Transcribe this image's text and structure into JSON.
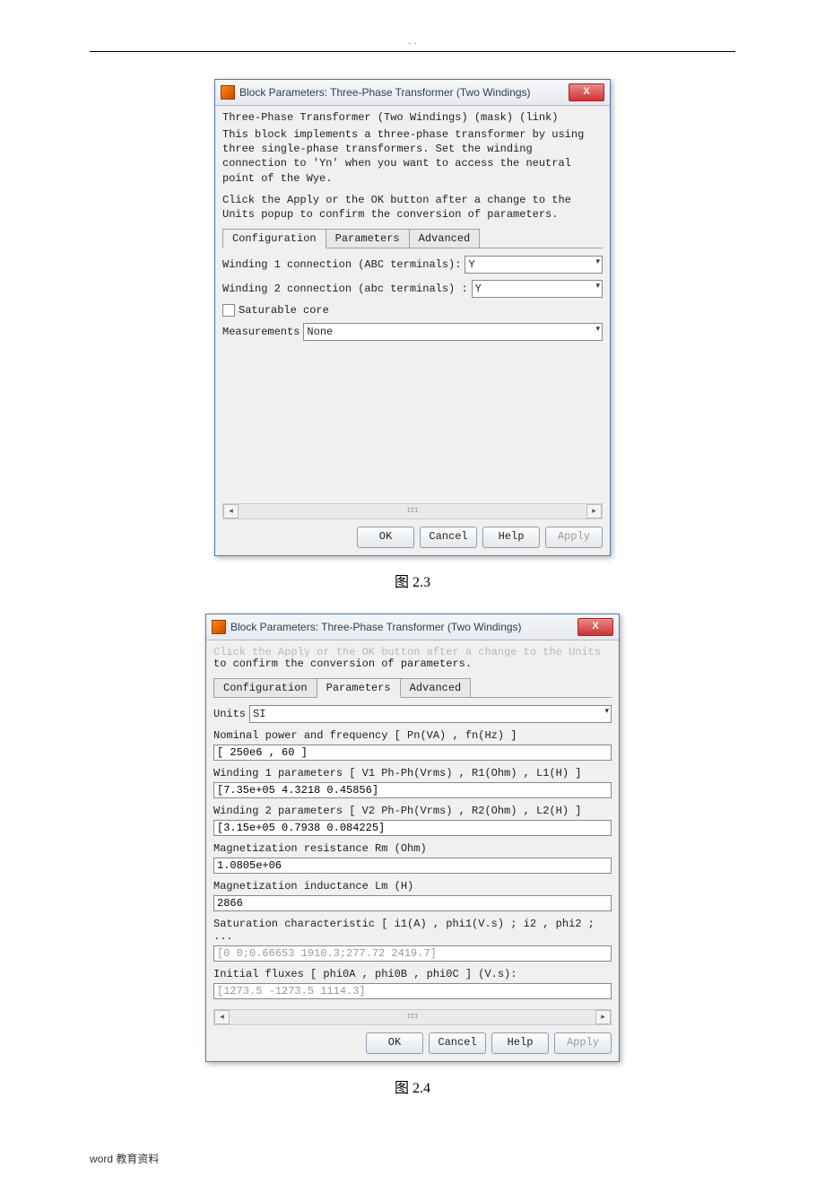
{
  "page_marker": ". .",
  "footer": "word 教育资料",
  "caption1": "图 2.3",
  "caption2": "图 2.4",
  "dialog1": {
    "title": "Block Parameters: Three-Phase Transformer (Two Windings)",
    "close": "X",
    "mask_line": "Three-Phase Transformer (Two Windings) (mask) (link)",
    "desc1": "This block implements a three-phase transformer by using three single-phase transformers. Set the winding connection to 'Yn' when you want to access the neutral point of the Wye.",
    "desc2": "Click the Apply or the OK button after a change to the Units popup to confirm the conversion of parameters.",
    "tabs": {
      "config": "Configuration",
      "params": "Parameters",
      "adv": "Advanced"
    },
    "winding1_label": "Winding 1 connection (ABC terminals):",
    "winding1_value": "Y",
    "winding2_label": "Winding 2 connection (abc terminals) :",
    "winding2_value": "Y",
    "saturable": "Saturable core",
    "meas_label": "Measurements",
    "meas_value": "None",
    "hscroll_thumb": "III",
    "ok": "OK",
    "cancel": "Cancel",
    "help": "Help",
    "apply": "Apply"
  },
  "dialog2": {
    "title": "Block Parameters: Three-Phase Transformer (Two Windings)",
    "close": "X",
    "cut_text": "Click the Apply or the OK button after a change to the Units popup",
    "desc2": "to confirm the conversion of parameters.",
    "tabs": {
      "config": "Configuration",
      "params": "Parameters",
      "adv": "Advanced"
    },
    "units_label": "Units",
    "units_value": "SI",
    "nominal_label": "Nominal power and frequency  [ Pn(VA) , fn(Hz) ]",
    "nominal_value": "[ 250e6 , 60 ]",
    "w1_label": "Winding 1 parameters [ V1 Ph-Ph(Vrms) , R1(Ohm) , L1(H) ]",
    "w1_value": "[7.35e+05 4.3218 0.45856]",
    "w2_label": "Winding 2 parameters [ V2 Ph-Ph(Vrms) , R2(Ohm) , L2(H) ]",
    "w2_value": "[3.15e+05 0.7938 0.084225]",
    "rm_label": "Magnetization resistance  Rm (Ohm)",
    "rm_value": "1.0805e+06",
    "lm_label": "Magnetization inductance  Lm (H)",
    "lm_value": "2866",
    "sat_label": "Saturation characteristic [ i1(A) ,  phi1(V.s) ;  i2 , phi2 ; ...",
    "sat_value": "[0 0;0.66653 1910.3;277.72 2419.7]",
    "flux_label": "Initial fluxes [ phi0A , phi0B , phi0C ] (V.s):",
    "flux_value": "[1273.5 -1273.5 1114.3]",
    "hscroll_thumb": "III",
    "ok": "OK",
    "cancel": "Cancel",
    "help": "Help",
    "apply": "Apply"
  }
}
